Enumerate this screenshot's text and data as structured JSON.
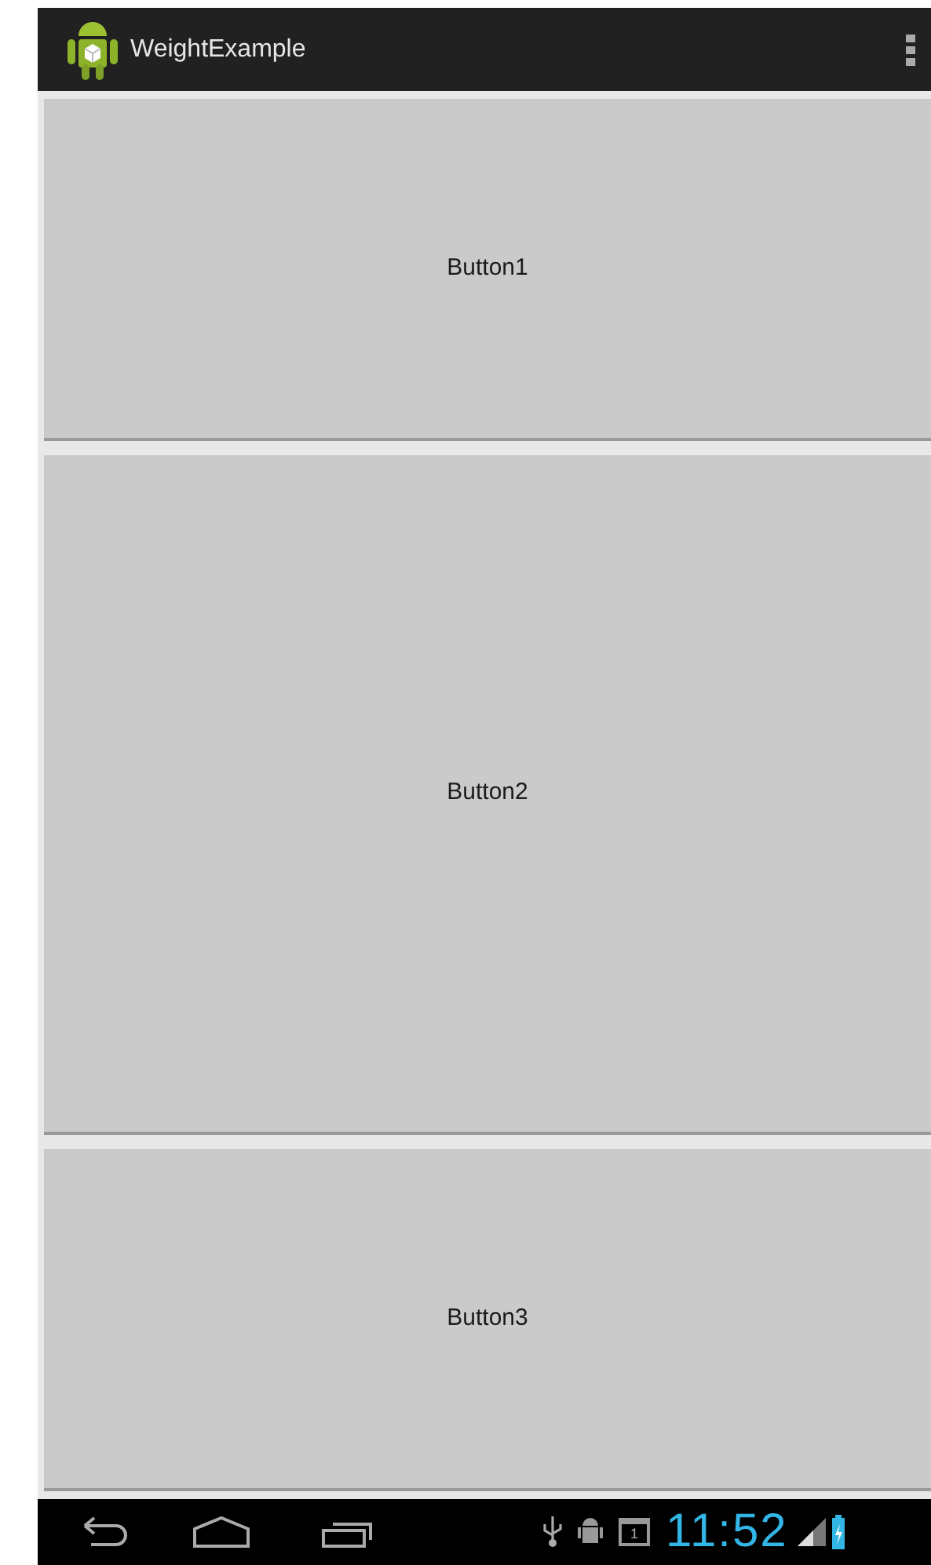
{
  "action_bar": {
    "title": "WeightExample"
  },
  "buttons": [
    {
      "label": "Button1"
    },
    {
      "label": "Button2"
    },
    {
      "label": "Button3"
    }
  ],
  "status_bar": {
    "calendar_day": "1",
    "time": "11:52"
  }
}
